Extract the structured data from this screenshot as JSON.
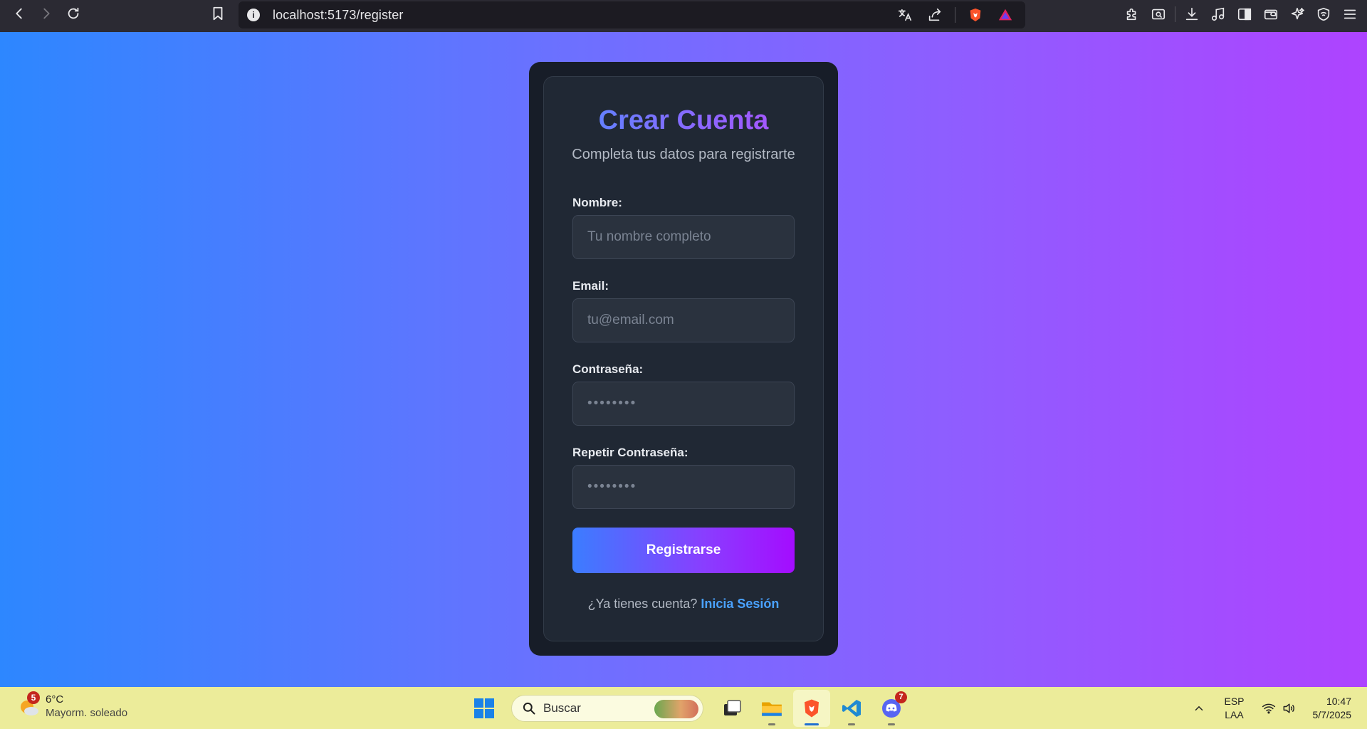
{
  "browser": {
    "url": "localhost:5173/register"
  },
  "form": {
    "title": "Crear Cuenta",
    "subtitle": "Completa tus datos para registrarte",
    "name_label": "Nombre:",
    "name_placeholder": "Tu nombre completo",
    "email_label": "Email:",
    "email_placeholder": "tu@email.com",
    "password_label": "Contraseña:",
    "password_placeholder": "••••••••",
    "repeat_password_label": "Repetir Contraseña:",
    "repeat_password_placeholder": "••••••••",
    "submit_label": "Registrarse",
    "footer_text": "¿Ya tienes cuenta?",
    "footer_link": "Inicia Sesión"
  },
  "taskbar": {
    "weather_badge": "5",
    "weather_temp": "6°C",
    "weather_desc": "Mayorm. soleado",
    "search_label": "Buscar",
    "discord_badge": "7",
    "lang_line1": "ESP",
    "lang_line2": "LAA",
    "time": "10:47",
    "date": "5/7/2025"
  },
  "colors": {
    "page_gradient_start": "#2d87ff",
    "page_gradient_end": "#ae43ff",
    "card_background": "#202834",
    "link_color": "#4aa2ff",
    "taskbar_background": "#ecec9a"
  },
  "icons": [
    "back-icon",
    "forward-icon",
    "reload-icon",
    "bookmark-icon",
    "info-icon",
    "translate-icon",
    "share-icon",
    "brave-shields-icon",
    "brave-rewards-icon",
    "extensions-icon",
    "screenshot-icon",
    "download-icon",
    "media-icon",
    "sidebar-icon",
    "wallet-icon",
    "leo-ai-icon",
    "vpn-icon",
    "menu-icon",
    "windows-start-icon",
    "search-icon",
    "task-view-icon",
    "file-explorer-icon",
    "brave-browser-icon",
    "vscode-icon",
    "discord-icon",
    "chevron-up-icon",
    "wifi-icon",
    "volume-icon"
  ]
}
